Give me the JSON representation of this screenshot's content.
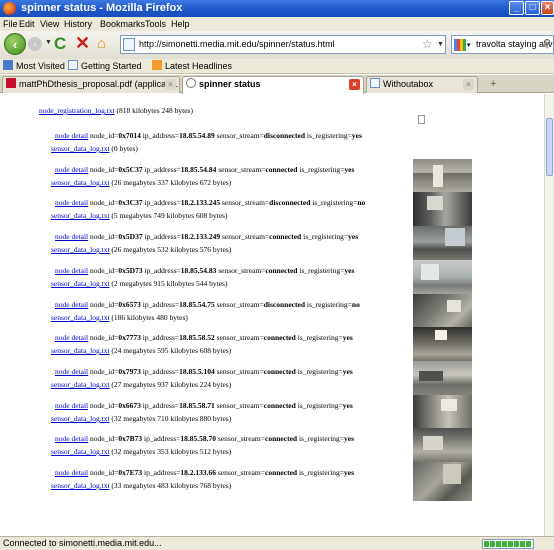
{
  "window": {
    "title": "spinner status - Mozilla Firefox"
  },
  "menu": [
    "File",
    "Edit",
    "View",
    "History",
    "Bookmarks",
    "Tools",
    "Help"
  ],
  "nav": {
    "url": "http://simonetti.media.mit.edu/spinner/status.html",
    "search_query": "travolta staying alive"
  },
  "bookmarks": [
    "Most Visited",
    "Getting Started",
    "Latest Headlines"
  ],
  "tabs": [
    {
      "label": "mattPhDthesis_proposal.pdf (applicatio...",
      "active": false
    },
    {
      "label": "spinner status",
      "active": true
    },
    {
      "label": "Withoutabox",
      "active": false
    }
  ],
  "content": {
    "registration_log": {
      "link": "node_registration_log.txt",
      "size": "(818 kilobytes 248 bytes)"
    },
    "labels": {
      "node_detail": "node detail",
      "sensor_log": "sensor_data_log.txt",
      "node_id": "node_id=",
      "ip_address": "ip_address=",
      "sensor_stream": "sensor_stream=",
      "is_registering": "is_registering="
    },
    "nodes": [
      {
        "node_id": "0x7014",
        "ip": "18.85.54.89",
        "stream": "disconnected",
        "registering": "yes",
        "size": "(0 bytes)"
      },
      {
        "node_id": "0x5C37",
        "ip": "18.85.54.84",
        "stream": "connected",
        "registering": "yes",
        "size": "(26 megabytes 337 kilobytes 672 bytes)"
      },
      {
        "node_id": "0x3C37",
        "ip": "18.2.133.245",
        "stream": "disconnected",
        "registering": "no",
        "size": "(5 megabytes 749 kilobytes 608 bytes)"
      },
      {
        "node_id": "0x5D37",
        "ip": "18.2.133.249",
        "stream": "connected",
        "registering": "yes",
        "size": "(26 megabytes 532 kilobytes 576 bytes)"
      },
      {
        "node_id": "0x5D73",
        "ip": "18.85.54.83",
        "stream": "connected",
        "registering": "yes",
        "size": "(2 megabytes 915 kilobytes 544 bytes)"
      },
      {
        "node_id": "0x6573",
        "ip": "18.85.54.75",
        "stream": "disconnected",
        "registering": "no",
        "size": "(186 kilobytes 480 bytes)"
      },
      {
        "node_id": "0x7773",
        "ip": "18.85.58.52",
        "stream": "connected",
        "registering": "yes",
        "size": "(24 megabytes 595 kilobytes 608 bytes)"
      },
      {
        "node_id": "0x7973",
        "ip": "18.85.5.104",
        "stream": "connected",
        "registering": "yes",
        "size": "(27 megabytes 937 kilobytes 224 bytes)"
      },
      {
        "node_id": "0x6673",
        "ip": "18.85.58.71",
        "stream": "connected",
        "registering": "yes",
        "size": "(32 megabytes 710 kilobytes 880 bytes)"
      },
      {
        "node_id": "0x7B73",
        "ip": "18.85.58.70",
        "stream": "connected",
        "registering": "yes",
        "size": "(32 megabytes 353 kilobytes 512 bytes)"
      },
      {
        "node_id": "0x7E73",
        "ip": "18.2.133.66",
        "stream": "connected",
        "registering": "yes",
        "size": "(33 megabytes 483 kilobytes 768 bytes)"
      }
    ]
  },
  "status": {
    "text": "Connected to simonetti.media.mit.edu...",
    "progress": 1.0
  },
  "colors": {
    "link": "#0000cc",
    "titlebar": "#1c55c8",
    "progress": "#3cb43c"
  }
}
